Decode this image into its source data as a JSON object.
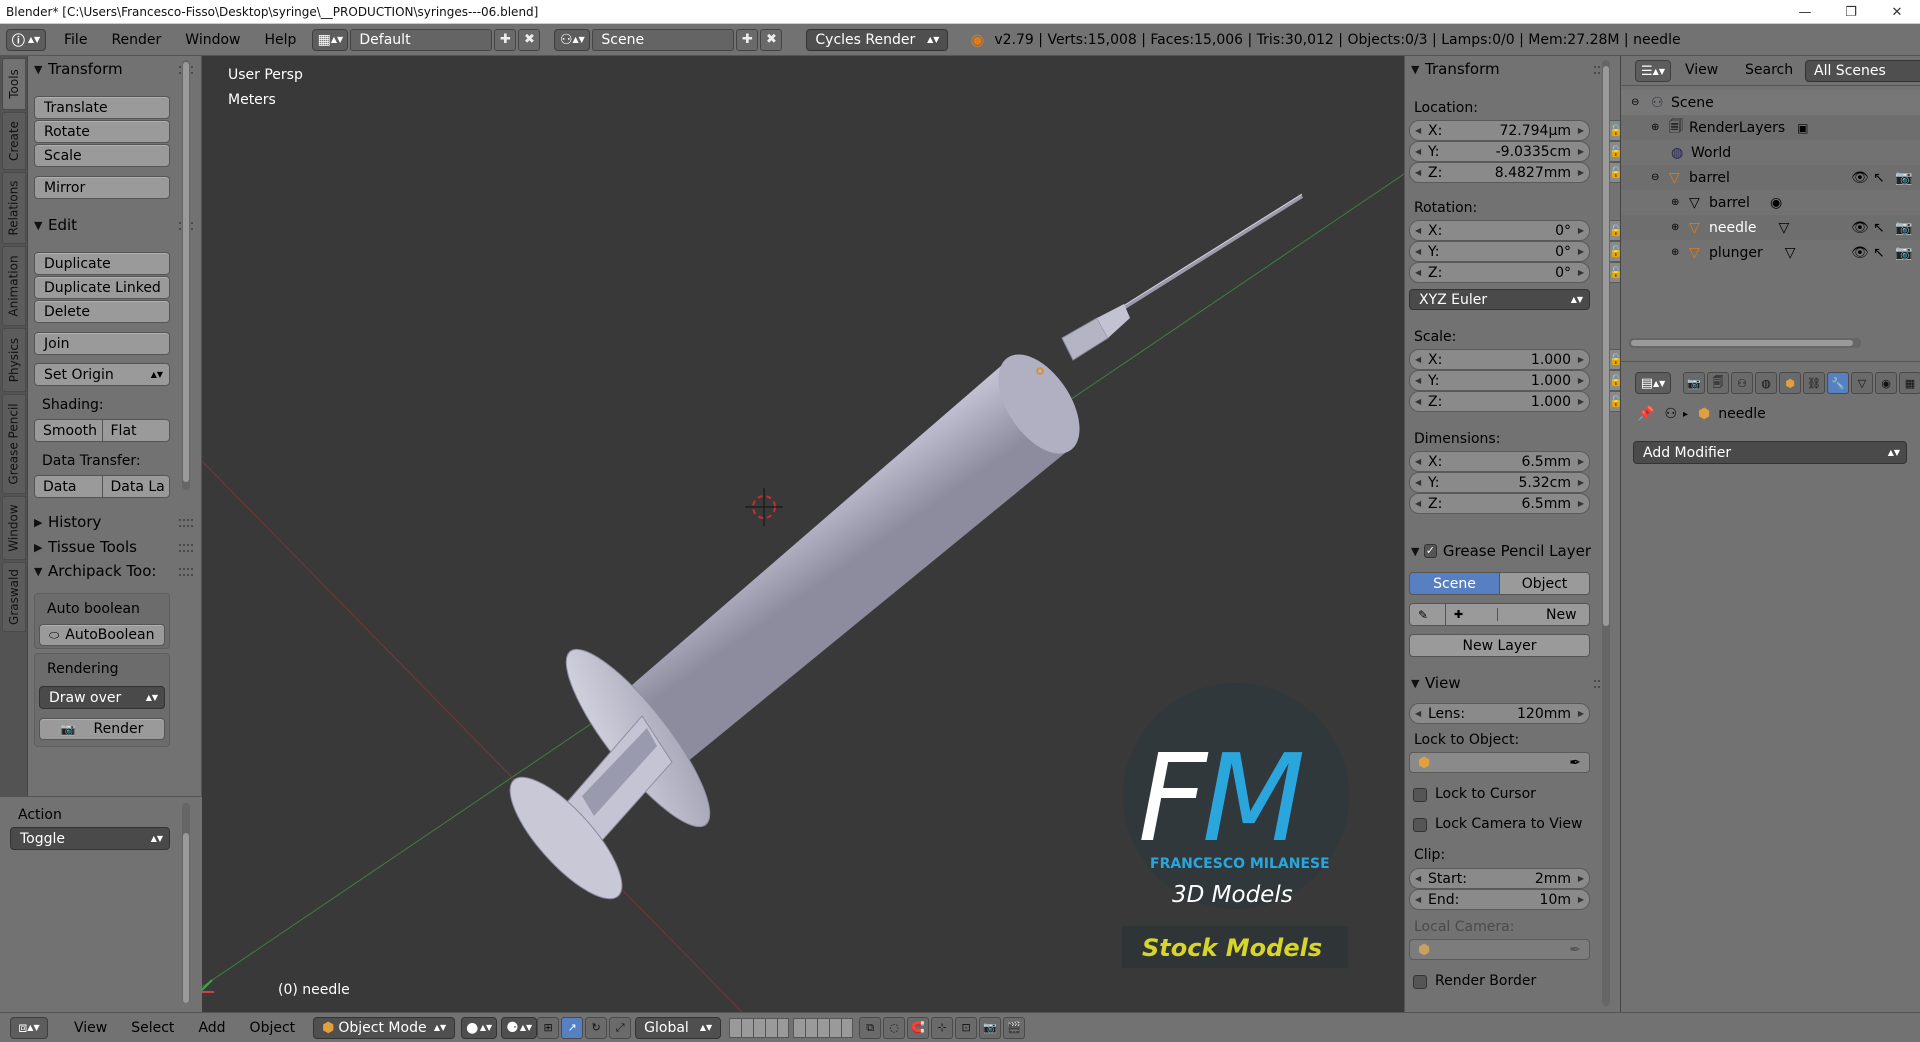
{
  "window": {
    "title": "Blender* [C:\\Users\\Francesco-Fisso\\Desktop\\syringe\\__PRODUCTION\\syringes---06.blend]",
    "minimize": "—",
    "maximize": "❐",
    "close": "✕"
  },
  "info_header": {
    "menus": [
      "File",
      "Render",
      "Window",
      "Help"
    ],
    "screen_layout": "Default",
    "scene": "Scene",
    "render_engine": "Cycles Render",
    "stats": "v2.79 | Verts:15,008 | Faces:15,006 | Tris:30,012 | Objects:0/3 | Lamps:0/0 | Mem:27.28M | needle"
  },
  "side_tabs": [
    "Tools",
    "Create",
    "Relations",
    "Animation",
    "Physics",
    "Grease Pencil",
    "Window",
    "Graswald"
  ],
  "tool_shelf": {
    "transform": {
      "title": "Transform",
      "buttons": [
        "Translate",
        "Rotate",
        "Scale",
        "Mirror"
      ]
    },
    "edit": {
      "title": "Edit",
      "buttons": [
        "Duplicate",
        "Duplicate Linked",
        "Delete",
        "Join"
      ],
      "set_origin": "Set Origin",
      "shading_label": "Shading:",
      "shading": [
        "Smooth",
        "Flat"
      ],
      "data_transfer_label": "Data Transfer:",
      "data_transfer": [
        "Data",
        "Data La"
      ]
    },
    "history": "History",
    "tissue_tools": "Tissue Tools",
    "archipack": {
      "title": "Archipack Too:",
      "auto_boolean_label": "Auto boolean",
      "auto_boolean_button": "AutoBoolean",
      "rendering_label": "Rendering",
      "draw_over": "Draw over",
      "render_button": "Render"
    }
  },
  "operator": {
    "title": "Action",
    "value": "Toggle"
  },
  "viewport": {
    "view_name": "User Persp",
    "units": "Meters",
    "active_object": "(0) needle",
    "watermark": {
      "initials_f": "F",
      "initials_m": "M",
      "line1": "FRANCESCO MILANESE",
      "line2": "3D Models",
      "line3": "Stock Models"
    }
  },
  "n_panel": {
    "transform_title": "Transform",
    "location_label": "Location:",
    "location": [
      {
        "axis": "X:",
        "value": "72.794µm"
      },
      {
        "axis": "Y:",
        "value": "-9.0335cm"
      },
      {
        "axis": "Z:",
        "value": "8.4827mm"
      }
    ],
    "rotation_label": "Rotation:",
    "rotation": [
      {
        "axis": "X:",
        "value": "0°"
      },
      {
        "axis": "Y:",
        "value": "0°"
      },
      {
        "axis": "Z:",
        "value": "0°"
      }
    ],
    "rotation_mode": "XYZ Euler",
    "scale_label": "Scale:",
    "scale": [
      {
        "axis": "X:",
        "value": "1.000"
      },
      {
        "axis": "Y:",
        "value": "1.000"
      },
      {
        "axis": "Z:",
        "value": "1.000"
      }
    ],
    "dimensions_label": "Dimensions:",
    "dimensions": [
      {
        "axis": "X:",
        "value": "6.5mm"
      },
      {
        "axis": "Y:",
        "value": "5.32cm"
      },
      {
        "axis": "Z:",
        "value": "6.5mm"
      }
    ],
    "grease_title": "Grease Pencil Layer",
    "grease_scene": "Scene",
    "grease_object": "Object",
    "grease_new": "New",
    "grease_new_layer": "New Layer",
    "view_title": "View",
    "lens_label": "Lens:",
    "lens_value": "120mm",
    "lock_object_label": "Lock to Object:",
    "lock_cursor": "Lock to Cursor",
    "lock_camera": "Lock Camera to View",
    "clip_label": "Clip:",
    "clip_start_label": "Start:",
    "clip_start": "2mm",
    "clip_end_label": "End:",
    "clip_end": "10m",
    "local_camera_label": "Local Camera:",
    "render_border": "Render Border"
  },
  "outliner": {
    "view": "View",
    "search": "Search",
    "filter": "All Scenes",
    "items": [
      {
        "name": "Scene",
        "level": 0
      },
      {
        "name": "RenderLayers",
        "level": 1
      },
      {
        "name": "World",
        "level": 1
      },
      {
        "name": "barrel",
        "level": 1
      },
      {
        "name": "barrel",
        "level": 2
      },
      {
        "name": "needle",
        "level": 2
      },
      {
        "name": "plunger",
        "level": 2
      }
    ]
  },
  "properties": {
    "object_name": "needle",
    "add_modifier": "Add Modifier"
  },
  "bottom_header": {
    "menus": [
      "View",
      "Select",
      "Add",
      "Object"
    ],
    "mode": "Object Mode",
    "orientation": "Global"
  },
  "colors": {
    "panel": "#727272",
    "viewport": "#393939",
    "accent": "#5680c2",
    "watermark_blue": "#2aa6dc",
    "watermark_yellow": "#d8d52a"
  }
}
